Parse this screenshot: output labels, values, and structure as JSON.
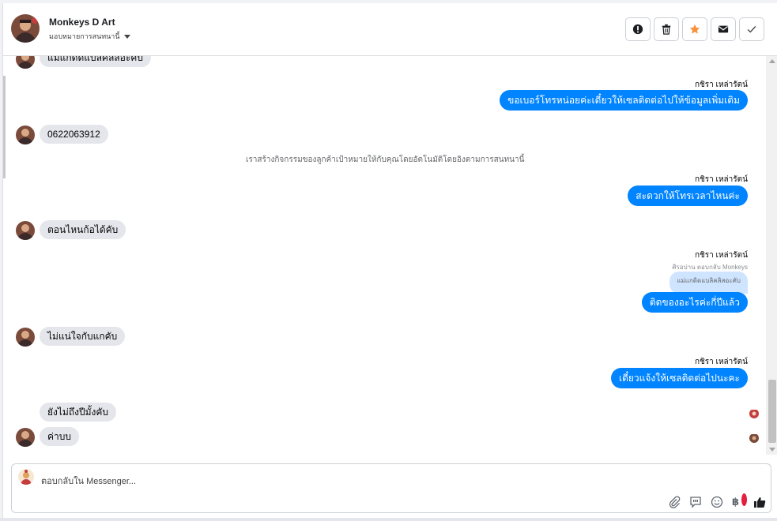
{
  "header": {
    "name": "Monkeys D Art",
    "assign_label": "มอบหมายการสนทนานี้"
  },
  "actions": [
    {
      "icon": "alert-icon",
      "name": "mark-spam-button"
    },
    {
      "icon": "trash-icon",
      "name": "delete-button"
    },
    {
      "icon": "star-icon",
      "name": "star-button",
      "color": "#f7923b"
    },
    {
      "icon": "envelope-icon",
      "name": "mark-unread-button"
    },
    {
      "icon": "check-icon",
      "name": "mark-done-button"
    }
  ],
  "messages": {
    "m0": "แม่แกดิดแบลิคลิสอะคับ",
    "s1": "กชิรา เหล่ารัตน์",
    "o1": "ขอเบอร์โทรหน่อยค่ะเดี๋ยวให้เซลติดต่อไปให้ข้อมูลเพิ่มเติม",
    "i1": "0622063912",
    "sys1": "เราสร้างกิจกรรมของลูกค้าเป้าหมายให้กับคุณโดยอัตโนมัติโดยอิงตามการสนทนานี้",
    "s2": "กชิรา เหล่ารัตน์",
    "o2": "สะดวกให้โทรเวลาไหนค่ะ",
    "i2": "ตอนไหนก้อได้คับ",
    "s3": "กชิรา เหล่ารัตน์",
    "reply_meta": "ศิรอบ่าน ตอบกลับ Monkeys",
    "reply_quote": "แม่แกดิดแบลิคลิสอะคับ",
    "o3": "ติดของอะไรค่ะกี่ปีแล้ว",
    "i3": "ไม่แน่ใจกับแกคับ",
    "s4": "กชิรา เหล่ารัตน์",
    "o4": "เดี๋ยวแจ้งให้เซลติดต่อไปนะคะ",
    "i4": "ยังไม่ถึงปีมั้งคับ",
    "i5": "ค่าบบ"
  },
  "composer": {
    "placeholder": "ตอบกลับใน Messenger...",
    "tools": [
      "paperclip-icon",
      "saved-reply-icon",
      "emoji-icon",
      "baht-icon",
      "thumbs-up-icon"
    ],
    "baht_symbol": "฿"
  },
  "colors": {
    "outgoing_bubble": "#0084ff",
    "incoming_bubble": "#e4e6eb",
    "accent_star": "#f7923b"
  }
}
